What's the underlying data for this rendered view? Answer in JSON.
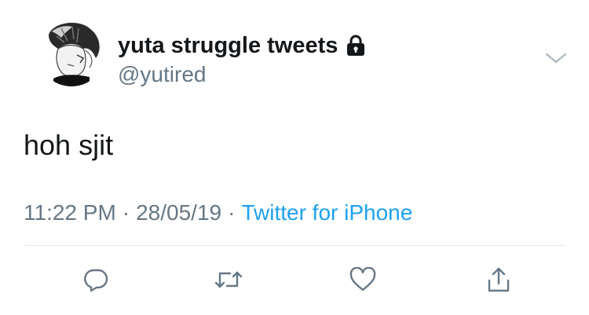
{
  "tweet": {
    "display_name": "yuta struggle tweets",
    "handle": "@yutired",
    "text": "hoh sjit",
    "time": "11:22 PM",
    "date": "28/05/19",
    "separator": "·",
    "source": "Twitter for iPhone",
    "protected_icon": "lock-icon",
    "menu_icon": "chevron-down-icon"
  },
  "actions": [
    {
      "name": "reply",
      "icon": "reply-icon"
    },
    {
      "name": "retweet",
      "icon": "retweet-icon"
    },
    {
      "name": "like",
      "icon": "heart-icon"
    },
    {
      "name": "share",
      "icon": "share-icon"
    }
  ],
  "colors": {
    "text": "#14171a",
    "secondary": "#657786",
    "link": "#1da1f2",
    "divider": "#e1e8ed"
  }
}
